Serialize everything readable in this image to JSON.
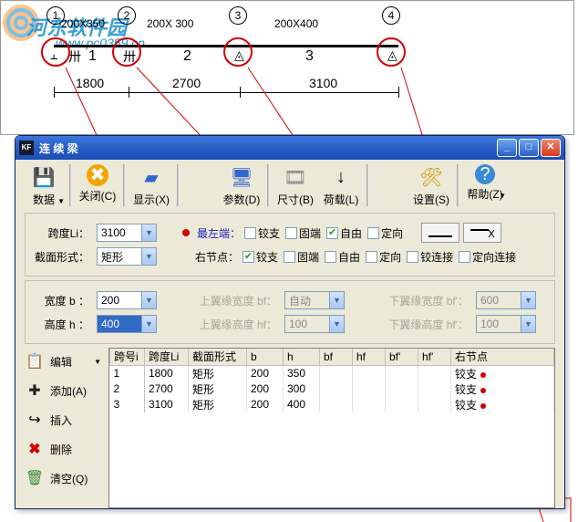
{
  "diagram": {
    "nodes": [
      "1",
      "2",
      "3",
      "4"
    ],
    "span_labels": [
      "1",
      "2",
      "3"
    ],
    "sections": [
      "200X350",
      "200X 300",
      "200X400"
    ],
    "lengths": [
      "1800",
      "2700",
      "3100"
    ]
  },
  "watermark": {
    "text": "河东软件园",
    "url": "www.pc0359.cn"
  },
  "window": {
    "title": "连 续 梁",
    "toolbar": [
      {
        "label": "数据",
        "key": "data",
        "icon": "📊",
        "dd": true
      },
      {
        "label": "关闭(C)",
        "key": "close",
        "icon": "✖"
      },
      {
        "label": "显示(X)",
        "key": "show",
        "icon": "🗔"
      },
      {
        "label": "参数(D)",
        "key": "param",
        "icon": "🖥"
      },
      {
        "label": "尺寸(B)",
        "key": "dim",
        "icon": "🎞"
      },
      {
        "label": "荷载(L)",
        "key": "load",
        "icon": "↓"
      },
      {
        "label": "设置(S)",
        "key": "set",
        "icon": "🛠"
      },
      {
        "label": "帮助(Z)",
        "key": "help",
        "icon": "❔",
        "dd": true
      }
    ]
  },
  "panel1": {
    "span_li_label": "跨度Li：",
    "span_li_value": "3100",
    "section_label": "截面形式：",
    "section_value": "矩形",
    "leftmost": "最左端：",
    "rightnode": "右节点：",
    "opts": {
      "jiaozhi": "铰支",
      "guduan": "固端",
      "ziyou": "自由",
      "dingxiang": "定向",
      "jiaolianjie": "铰连接",
      "dingxianglianjie": "定向连接"
    }
  },
  "panel2": {
    "width_label": "宽度 b ：",
    "width_value": "200",
    "height_label": "高度 h ：",
    "height_value": "400",
    "uf_w_label": "上翼缘宽度 bf：",
    "uf_w_value": "自动",
    "uf_h_label": "上翼缘高度 hf：",
    "uf_h_value": "100",
    "lf_w_label": "下翼缘宽度 bf'：",
    "lf_w_value": "600",
    "lf_h_label": "下翼缘高度 hf'：",
    "lf_h_value": "100"
  },
  "sidebar": [
    {
      "label": "编辑",
      "icon": "📋",
      "dd": true
    },
    {
      "label": "添加(A)",
      "icon": "✚"
    },
    {
      "label": "插入",
      "icon": "↩"
    },
    {
      "label": "删除",
      "icon": "✖"
    },
    {
      "label": "清空(Q)",
      "icon": "🗑"
    }
  ],
  "grid": {
    "headers": [
      "跨号i",
      "跨度Li",
      "截面形式",
      "b",
      "h",
      "bf",
      "hf",
      "bf'",
      "hf'",
      "右节点"
    ],
    "rows": [
      {
        "i": "1",
        "li": "1800",
        "sec": "矩形",
        "b": "200",
        "h": "350",
        "rn": "铰支"
      },
      {
        "i": "2",
        "li": "2700",
        "sec": "矩形",
        "b": "200",
        "h": "300",
        "rn": "铰支"
      },
      {
        "i": "3",
        "li": "3100",
        "sec": "矩形",
        "b": "200",
        "h": "400",
        "rn": "铰支"
      }
    ]
  }
}
